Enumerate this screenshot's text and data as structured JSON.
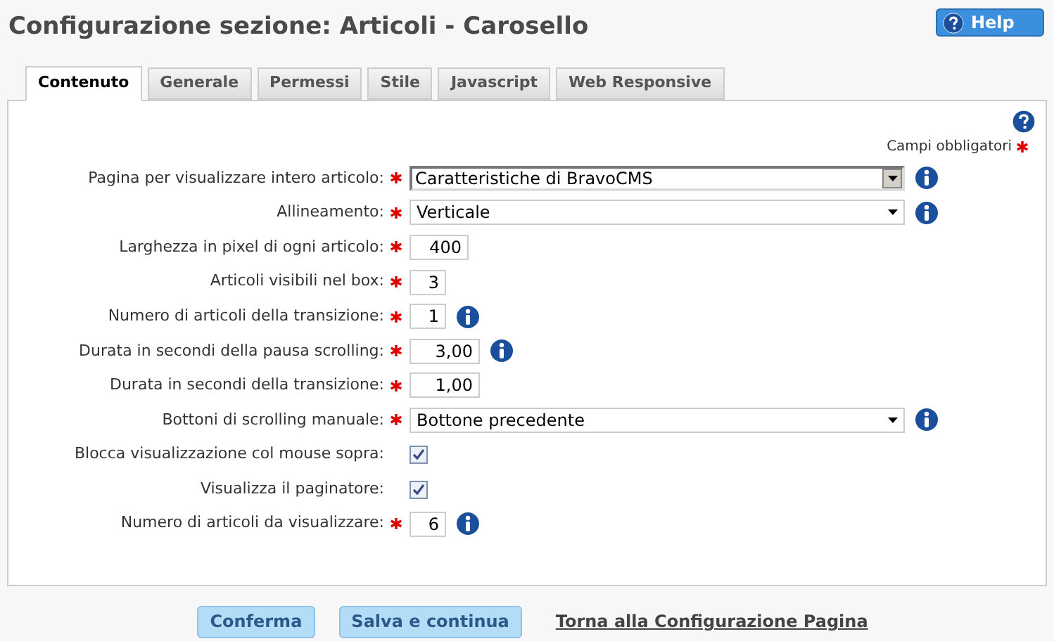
{
  "title": "Configurazione sezione: Articoli - Carosello",
  "help_button": "Help",
  "tabs": [
    {
      "label": "Contenuto",
      "selected": true
    },
    {
      "label": "Generale",
      "selected": false
    },
    {
      "label": "Permessi",
      "selected": false
    },
    {
      "label": "Stile",
      "selected": false
    },
    {
      "label": "Javascript",
      "selected": false
    },
    {
      "label": "Web Responsive",
      "selected": false
    }
  ],
  "required_note": "Campi obbligatori",
  "fields": [
    {
      "kind": "select",
      "label": "Pagina per visualizzare intero articolo:",
      "value": "Caratteristiche di BravoCMS",
      "required": true,
      "info": true,
      "classic": true
    },
    {
      "kind": "select",
      "label": "Allineamento:",
      "value": "Verticale",
      "required": true,
      "info": true,
      "classic": false
    },
    {
      "kind": "number",
      "label": "Larghezza in pixel di ogni articolo:",
      "value": "400",
      "required": true,
      "info": false
    },
    {
      "kind": "number",
      "label": "Articoli visibili nel box:",
      "value": "3",
      "required": true,
      "info": false
    },
    {
      "kind": "number",
      "label": "Numero di articoli della transizione:",
      "value": "1",
      "required": true,
      "info": true
    },
    {
      "kind": "number",
      "label": "Durata in secondi della pausa scrolling:",
      "value": "3,00",
      "required": true,
      "info": true
    },
    {
      "kind": "number",
      "label": "Durata in secondi della transizione:",
      "value": "1,00",
      "required": true,
      "info": false
    },
    {
      "kind": "select",
      "label": "Bottoni di scrolling manuale:",
      "value": "Bottone precedente",
      "required": true,
      "info": true,
      "classic": false
    },
    {
      "kind": "checkbox",
      "label": "Blocca visualizzazione col mouse sopra:",
      "checked": true,
      "required": false,
      "info": false
    },
    {
      "kind": "checkbox",
      "label": "Visualizza il paginatore:",
      "checked": true,
      "required": false,
      "info": false
    },
    {
      "kind": "number",
      "label": "Numero di articoli da visualizzare:",
      "value": "6",
      "required": true,
      "info": true
    }
  ],
  "buttons": [
    "Conferma",
    "Salva e continua"
  ],
  "back_link": "Torna alla Configurazione Pagina"
}
